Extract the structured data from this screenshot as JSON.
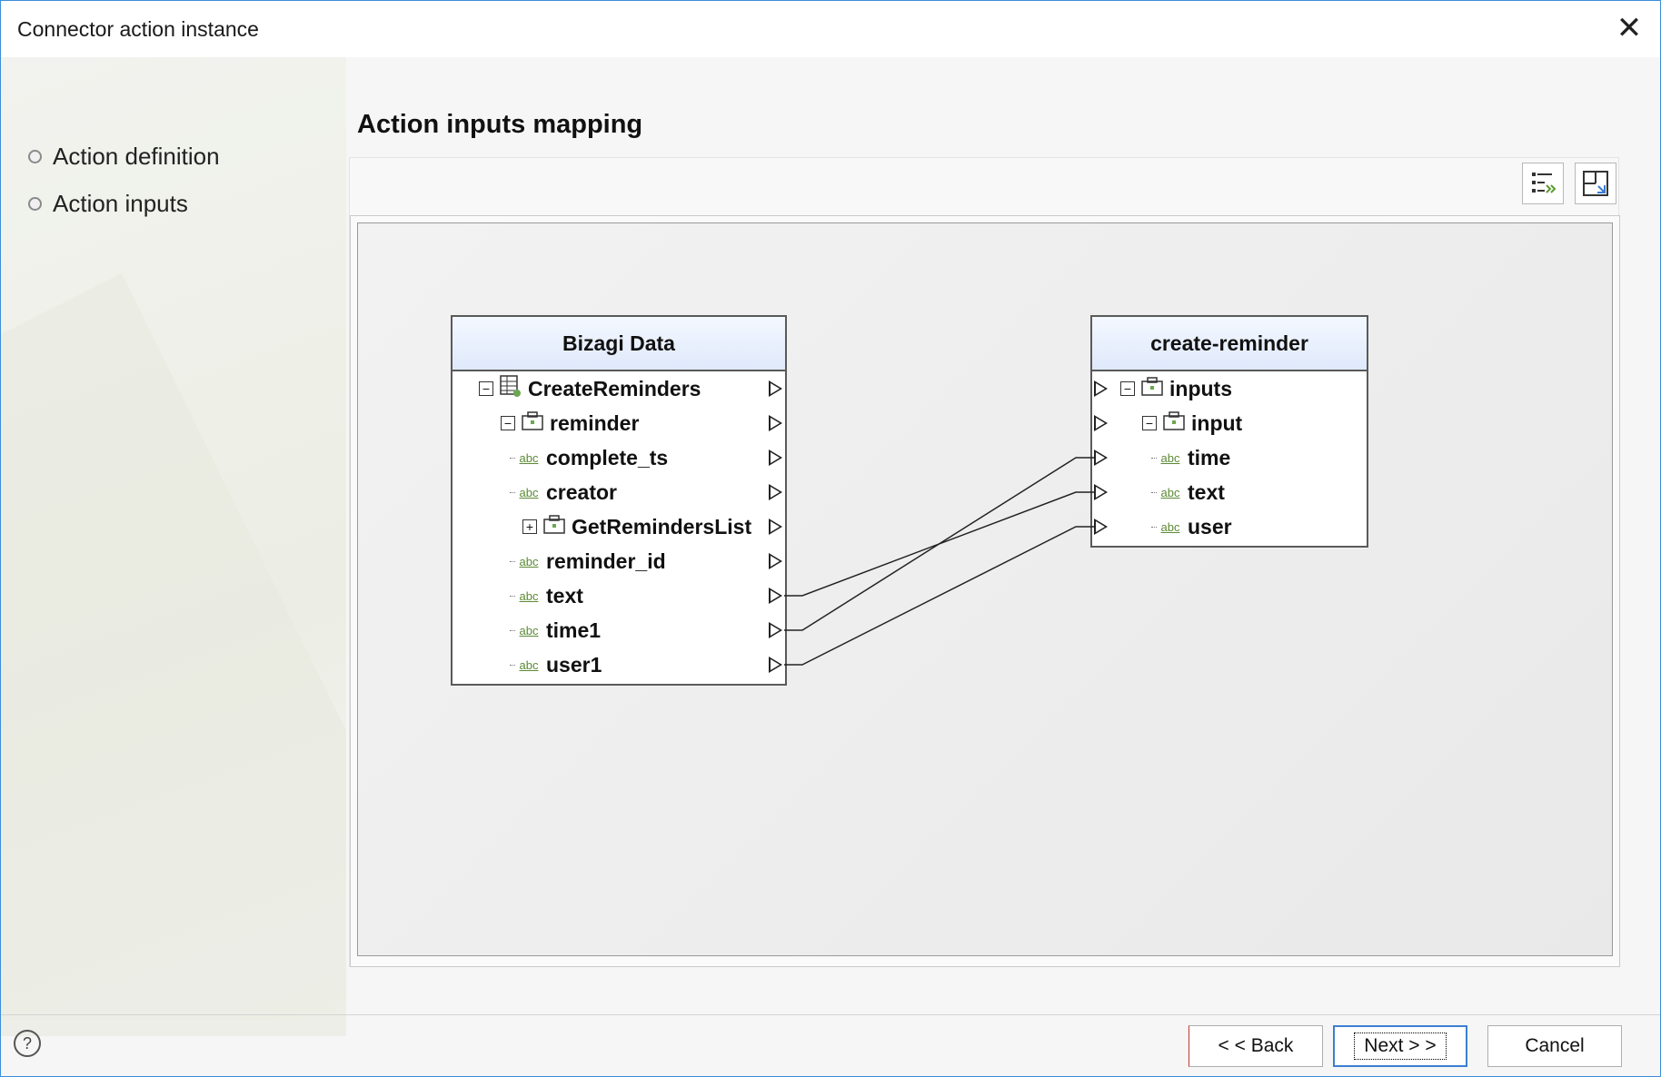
{
  "window": {
    "title": "Connector action instance",
    "close_icon": "close-icon"
  },
  "steps": [
    {
      "label": "Action definition"
    },
    {
      "label": "Action inputs"
    }
  ],
  "section_title": "Action inputs mapping",
  "toolbar": {
    "buttons": [
      {
        "icon": "auto-map-icon"
      },
      {
        "icon": "layout-icon"
      }
    ]
  },
  "left_panel": {
    "title": "Bizagi Data",
    "rows": [
      {
        "label": "CreateReminders",
        "toggle": "−",
        "icon": "entity-icon"
      },
      {
        "label": "reminder",
        "toggle": "−",
        "icon": "object-icon"
      },
      {
        "label": "complete_ts",
        "icon": "abc"
      },
      {
        "label": "creator",
        "icon": "abc"
      },
      {
        "label": "GetRemindersList",
        "toggle": "+",
        "icon": "object-icon"
      },
      {
        "label": "reminder_id",
        "icon": "abc"
      },
      {
        "label": "text",
        "icon": "abc"
      },
      {
        "label": "time1",
        "icon": "abc"
      },
      {
        "label": "user1",
        "icon": "abc"
      }
    ]
  },
  "right_panel": {
    "title": "create-reminder",
    "rows": [
      {
        "label": "inputs",
        "toggle": "−",
        "icon": "object-icon"
      },
      {
        "label": "input",
        "toggle": "−",
        "icon": "object-icon"
      },
      {
        "label": "time",
        "icon": "abc"
      },
      {
        "label": "text",
        "icon": "abc"
      },
      {
        "label": "user",
        "icon": "abc"
      }
    ]
  },
  "mappings": [
    {
      "from": "text",
      "to": "text"
    },
    {
      "from": "time1",
      "to": "time"
    },
    {
      "from": "user1",
      "to": "user"
    }
  ],
  "footer": {
    "help_icon": "help-icon",
    "back_label": "< < Back",
    "next_label": "Next > >",
    "cancel_label": "Cancel"
  }
}
